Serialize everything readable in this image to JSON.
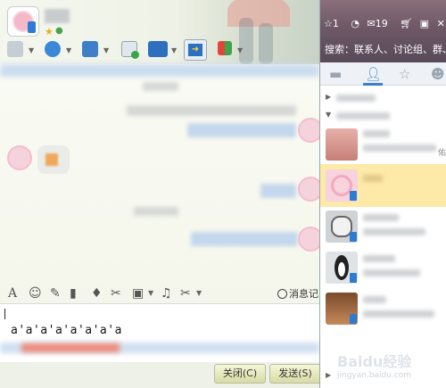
{
  "toolbar": {
    "icons": [
      "avatar-icon",
      "phone-icon",
      "video-icon",
      "folder-icon",
      "app-icon",
      "remote-desktop-icon",
      "share-screen-icon",
      "apps-grid-icon"
    ]
  },
  "input_toolbar": {
    "icons": [
      "font-icon",
      "emoji-icon",
      "nudge-icon",
      "gif-icon",
      "voice-icon",
      "screenshot-icon",
      "image-icon",
      "music-icon",
      "scissors-icon"
    ],
    "history_label": "消息记"
  },
  "input": {
    "typed_text": "a'a'a'a'a'a'a'a"
  },
  "footer": {
    "close_label": "关闭(C)",
    "send_label": "发送(S)"
  },
  "contacts": {
    "top_bar": {
      "star_count": "1",
      "mail_count": "19"
    },
    "search_text": "搜索：联系人、讨论组、群、企",
    "tabs": [
      "chat-tab",
      "contacts-tab",
      "favorites-tab",
      "groups-tab"
    ],
    "side_text": "佑"
  },
  "watermark": {
    "brand": "Baidu经验",
    "sub": "jingyan.baidu.com"
  },
  "colors": {
    "selected_row": "#fde9a8",
    "active_tab": "#3b7fcf",
    "panel_header": "#6e5866"
  }
}
